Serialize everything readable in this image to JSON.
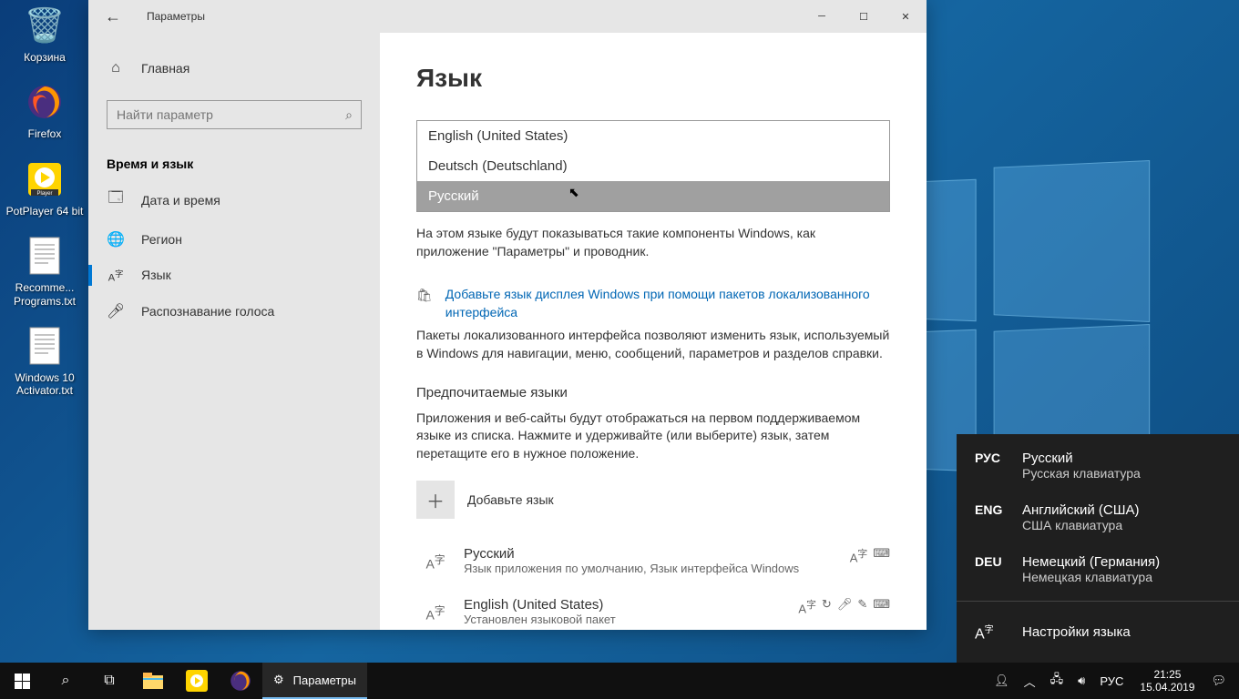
{
  "desktop": {
    "icons": [
      {
        "label": "Корзина"
      },
      {
        "label": "Firefox"
      },
      {
        "label": "PotPlayer 64 bit"
      },
      {
        "label": "Recomme... Programs.txt"
      },
      {
        "label": "Windows 10 Activator.txt"
      }
    ]
  },
  "window": {
    "title": "Параметры",
    "back_aria": "Назад",
    "sidebar": {
      "home": "Главная",
      "search_placeholder": "Найти параметр",
      "section": "Время и язык",
      "items": [
        {
          "label": "Дата и время"
        },
        {
          "label": "Регион"
        },
        {
          "label": "Язык"
        },
        {
          "label": "Распознавание голоса"
        }
      ]
    },
    "content": {
      "heading": "Язык",
      "dropdown": {
        "opt1": "English (United States)",
        "opt2": "Deutsch (Deutschland)",
        "opt3": "Русский"
      },
      "display_lang_desc": "На этом языке будут показываться такие компоненты Windows, как приложение \"Параметры\" и проводник.",
      "hint_link": "Добавьте язык дисплея Windows при помощи пакетов локализованного интерфейса",
      "packs_desc": "Пакеты локализованного интерфейса позволяют изменить язык, используемый в Windows для навигации, меню, сообщений, параметров и разделов справки.",
      "preferred_heading": "Предпочитаемые языки",
      "preferred_desc": "Приложения и веб-сайты будут отображаться на первом поддерживаемом языке из списка. Нажмите и удерживайте (или выберите) язык, затем перетащите его в нужное положение.",
      "add_lang": "Добавьте язык",
      "lang1": {
        "name": "Русский",
        "desc": "Язык приложения по умолчанию, Язык интерфейса Windows"
      },
      "lang2": {
        "name": "English (United States)",
        "desc": "Установлен языковой пакет"
      }
    }
  },
  "lang_flyout": {
    "opts": [
      {
        "code": "РУС",
        "name": "Русский",
        "kbd": "Русская клавиатура"
      },
      {
        "code": "ENG",
        "name": "Английский (США)",
        "kbd": "США клавиатура"
      },
      {
        "code": "DEU",
        "name": "Немецкий (Германия)",
        "kbd": "Немецкая клавиатура"
      }
    ],
    "settings": "Настройки языка"
  },
  "taskbar": {
    "app_label": "Параметры",
    "tray_lang": "РУС",
    "time": "21:25",
    "date": "15.04.2019"
  }
}
